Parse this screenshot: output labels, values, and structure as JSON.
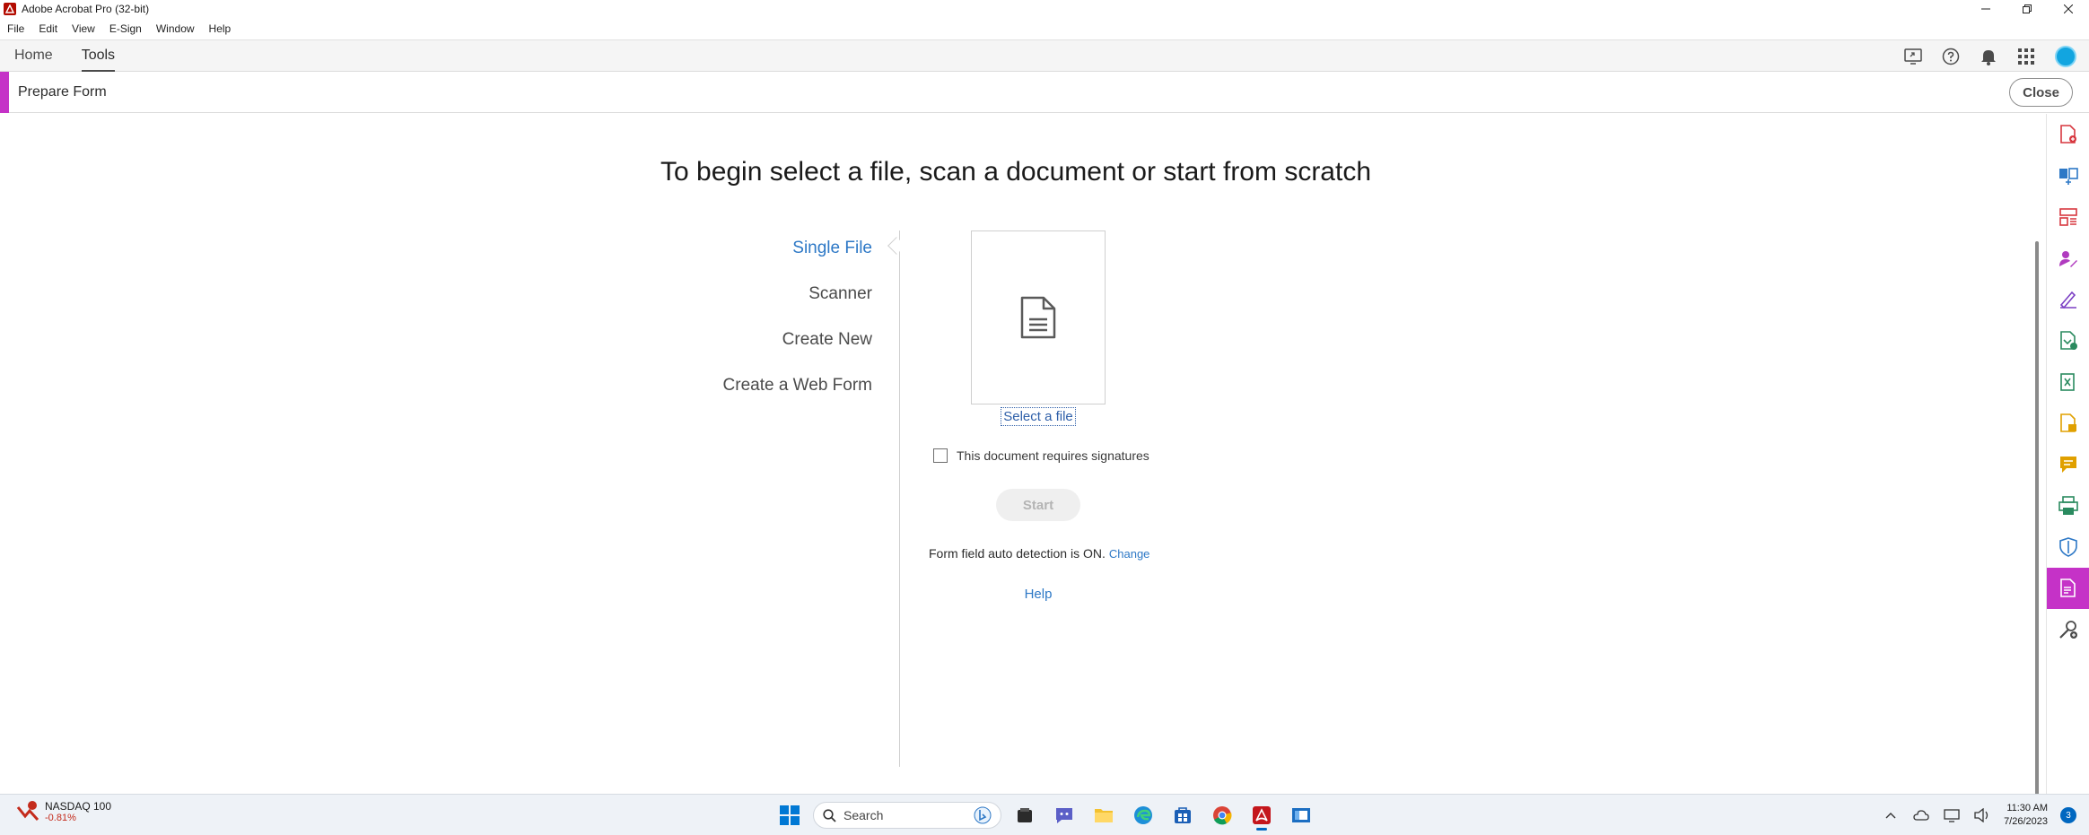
{
  "window": {
    "title": "Adobe Acrobat Pro (32-bit)",
    "controls": [
      "minimize",
      "restore",
      "close"
    ]
  },
  "menu": [
    "File",
    "Edit",
    "View",
    "E-Sign",
    "Window",
    "Help"
  ],
  "nav": {
    "tabs": [
      {
        "label": "Home",
        "active": false
      },
      {
        "label": "Tools",
        "active": true
      }
    ],
    "icons": [
      "share-screen-icon",
      "help-icon",
      "bell-icon",
      "apps-grid-icon",
      "avatar"
    ]
  },
  "tool": {
    "title": "Prepare Form",
    "close_label": "Close",
    "accent_color": "#c532c7"
  },
  "main": {
    "headline": "To begin select a file, scan a document or start from scratch",
    "options": [
      {
        "label": "Single File",
        "active": true
      },
      {
        "label": "Scanner",
        "active": false
      },
      {
        "label": "Create New",
        "active": false
      },
      {
        "label": "Create a Web Form",
        "active": false
      }
    ],
    "select_file_label": "Select a file",
    "signatures_checkbox": {
      "label": "This document requires signatures",
      "checked": false
    },
    "start_label": "Start",
    "auto_detection_text": "Form field auto detection is ON.",
    "change_label": "Change",
    "help_label": "Help"
  },
  "rail": {
    "items": [
      {
        "name": "create-pdf-icon",
        "color": "#d7373f"
      },
      {
        "name": "combine-files-icon",
        "color": "#2d78c6"
      },
      {
        "name": "organize-pages-icon",
        "color": "#d7373f"
      },
      {
        "name": "request-esign-icon",
        "color": "#b03bbf"
      },
      {
        "name": "fill-sign-icon",
        "color": "#7b3fc4"
      },
      {
        "name": "edit-pdf-icon",
        "color": "#2a8a5f"
      },
      {
        "name": "export-pdf-icon",
        "color": "#2a8a5f"
      },
      {
        "name": "scan-ocr-icon",
        "color": "#e0a000"
      },
      {
        "name": "comment-icon",
        "color": "#e0a000"
      },
      {
        "name": "print-production-icon",
        "color": "#2a8a5f"
      },
      {
        "name": "protect-icon",
        "color": "#2d78c6"
      },
      {
        "name": "prepare-form-icon",
        "color": "#ffffff",
        "active": true
      },
      {
        "name": "more-tools-icon",
        "color": "#4b4b4b"
      }
    ]
  },
  "taskbar": {
    "stock_name": "NASDAQ 100",
    "stock_change": "-0.81%",
    "search_placeholder": "Search",
    "apps": [
      "windows-start-icon",
      "search",
      "file-explorer-dark-icon",
      "teams-chat-icon",
      "folder-icon",
      "edge-icon",
      "store-icon",
      "chrome-icon",
      "acrobat-icon",
      "app-window-icon"
    ],
    "time": "11:30 AM",
    "date": "7/26/2023",
    "notification_count": "3"
  }
}
